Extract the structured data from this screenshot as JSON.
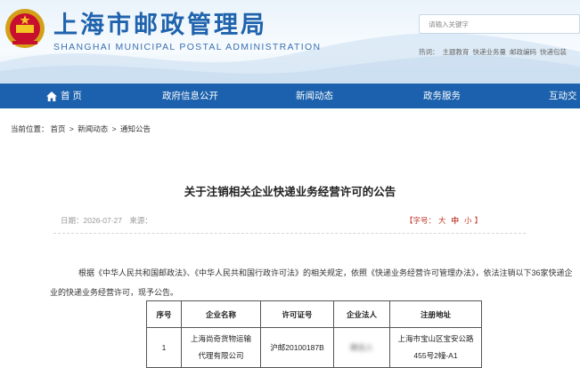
{
  "header": {
    "title_cn": "上海市邮政管理局",
    "title_en": "SHANGHAI MUNICIPAL POSTAL ADMINISTRATION",
    "search_placeholder": "请输入关键字",
    "hot_label": "热词：",
    "hot_words": [
      "主题教育",
      "快递业务量",
      "邮政编码",
      "快递包装"
    ]
  },
  "nav": {
    "items": [
      {
        "label": "首 页",
        "icon": "home-icon"
      },
      {
        "label": "政府信息公开"
      },
      {
        "label": "新闻动态"
      },
      {
        "label": "政务服务"
      },
      {
        "label": "互动交流"
      }
    ]
  },
  "breadcrumb": {
    "label": "当前位置：",
    "items": [
      "首页",
      "新闻动态",
      "通知公告"
    ],
    "sep": ">"
  },
  "article": {
    "title": "关于注销相关企业快递业务经营许可的公告",
    "date_label": "日期：",
    "date": "2026-07-27",
    "source_label": "来源：",
    "fontsize_open": "【字号：",
    "fontsize_options": [
      "大",
      "中",
      "小"
    ],
    "fontsize_close": "】",
    "body": "根据《中华人民共和国邮政法》、《中华人民共和国行政许可法》的相关规定，依照《快递业务经营许可管理办法》，依法注销以下36家快递企业的快递业务经营许可，现予公告。"
  },
  "table": {
    "headers": [
      "序号",
      "企业名称",
      "许可证号",
      "企业法人",
      "注册地址"
    ],
    "rows": [
      {
        "no": "1",
        "name_line1": "上海尚奇货物运输",
        "name_line2": "代理有限公司",
        "license": "沪邮20100187B",
        "legal": "韩无人",
        "addr_line1": "上海市宝山区宝安公路",
        "addr_line2": "455号2幢-A1"
      }
    ]
  },
  "colors": {
    "brand": "#1b61ad",
    "title_blue": "#1f63ad",
    "accent_red": "#c0392b"
  }
}
